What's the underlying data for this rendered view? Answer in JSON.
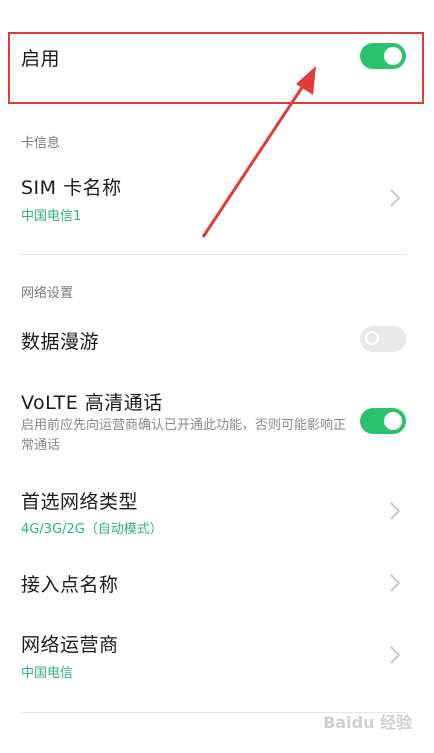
{
  "enable": {
    "label": "启用",
    "toggle": "on"
  },
  "card_info": {
    "section_label": "卡信息",
    "sim_name": {
      "title": "SIM 卡名称",
      "value": "中国电信1"
    }
  },
  "network_settings": {
    "section_label": "网络设置",
    "data_roaming": {
      "title": "数据漫游",
      "toggle": "off"
    },
    "volte": {
      "title": "VoLTE 高清通话",
      "description": "启用前应先向运营商确认已开通此功能，否则可能影响正常通话",
      "toggle": "on"
    },
    "preferred_network": {
      "title": "首选网络类型",
      "value": "4G/3G/2G（自动模式）"
    },
    "apn": {
      "title": "接入点名称"
    },
    "operator": {
      "title": "网络运营商",
      "value": "中国电信"
    }
  },
  "watermark": "Baidu 经验",
  "colors": {
    "accent": "#2bc26d",
    "annotation": "#e03b3b"
  }
}
